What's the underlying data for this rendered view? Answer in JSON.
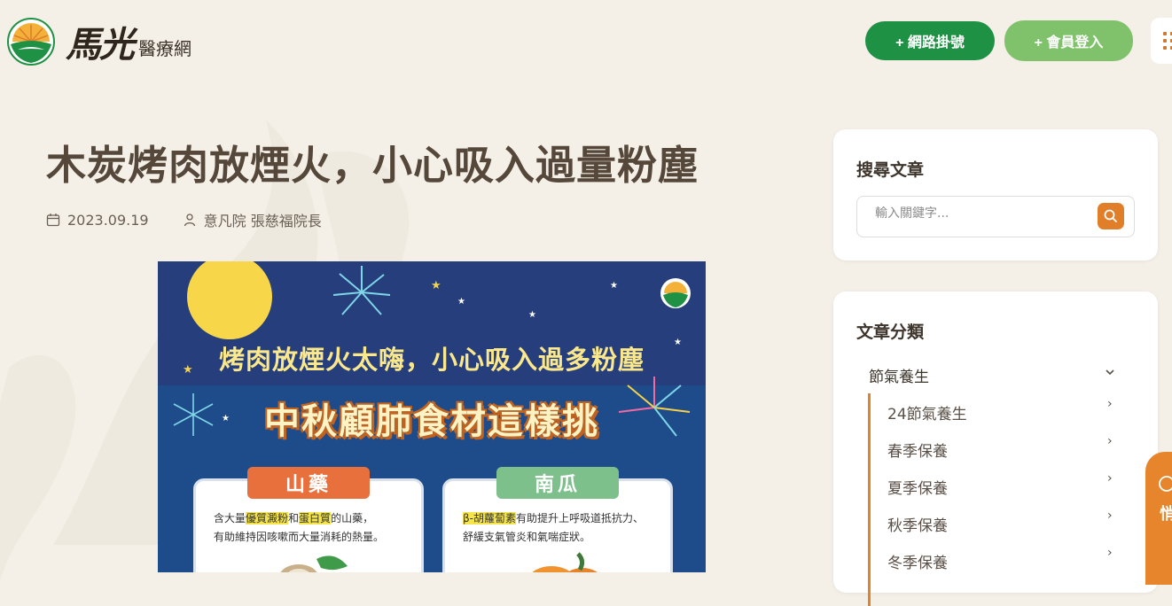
{
  "header": {
    "logo_main": "馬光",
    "logo_sub": "醫療網",
    "register_button": "+ 網路掛號",
    "login_button": "+ 會員登入"
  },
  "article": {
    "title": "木炭烤肉放煙火，小心吸入過量粉塵",
    "date": "2023.09.19",
    "author": "意凡院 張慈福院長",
    "poster": {
      "headline": "烤肉放煙火太嗨，小心吸入過多粉塵",
      "main_title": "中秋顧肺食材這樣挑",
      "card1_label": "山藥",
      "card1_text_a": "含大量",
      "card1_hl1": "優質澱粉",
      "card1_text_b": "和",
      "card1_hl2": "蛋白質",
      "card1_text_c": "的山藥，",
      "card1_text_d": "有助維持因咳嗽而大量消耗的熱量。",
      "card2_label": "南瓜",
      "card2_hl1": "β-胡蘿蔔素",
      "card2_text_a": "有助提升上呼吸道抵抗力、",
      "card2_text_b": "舒緩支氣管炎和氣喘症狀。"
    }
  },
  "sidebar": {
    "search_title": "搜尋文章",
    "search_placeholder": "輸入關鍵字...",
    "category_title": "文章分類",
    "category_head": "節氣養生",
    "category_items": [
      "24節氣養生",
      "春季保養",
      "夏季保養",
      "秋季保養",
      "冬季保養"
    ]
  },
  "side_tab": {
    "text": "悄"
  },
  "colors": {
    "background": "#f4f0e8",
    "register_green": "#1f9145",
    "login_green": "#7fc26b",
    "accent_orange": "#e07e2a",
    "poster_navy": "#263f7c",
    "card1_label": "#e8703c",
    "card2_label": "#7dc08c"
  },
  "icons": [
    "logo-emblem-icon",
    "calendar-icon",
    "user-icon",
    "search-icon",
    "chevron-down-icon",
    "chevron-right-icon",
    "menu-grid-icon"
  ]
}
